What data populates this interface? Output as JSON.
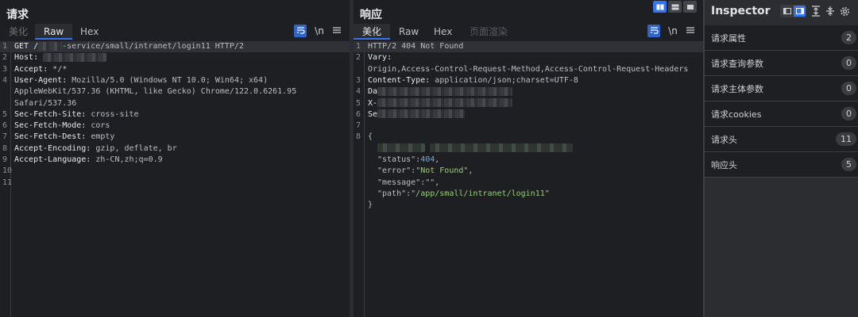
{
  "request": {
    "title": "请求",
    "tabs": [
      "美化",
      "Raw",
      "Hex"
    ],
    "active_tab": "Raw",
    "newline_label": "\\n",
    "menu_icon": "hamburger-icon",
    "lines": [
      {
        "n": "1",
        "k": "GET /",
        "v": "-service/small/intranet/login11 HTTP/2"
      },
      {
        "n": "2",
        "k": "Host: ",
        "v": ""
      },
      {
        "n": "3",
        "k": "Accept: ",
        "v": "*/*"
      },
      {
        "n": "4",
        "k": "User-Agent: ",
        "v": "Mozilla/5.0 (Windows NT 10.0; Win64; x64)"
      },
      {
        "n": "",
        "k": "",
        "v": "AppleWebKit/537.36 (KHTML, like Gecko) Chrome/122.0.6261.95"
      },
      {
        "n": "",
        "k": "",
        "v": "Safari/537.36"
      },
      {
        "n": "5",
        "k": "Sec-Fetch-Site: ",
        "v": "cross-site"
      },
      {
        "n": "6",
        "k": "Sec-Fetch-Mode: ",
        "v": "cors"
      },
      {
        "n": "7",
        "k": "Sec-Fetch-Dest: ",
        "v": "empty"
      },
      {
        "n": "8",
        "k": "Accept-Encoding: ",
        "v": "gzip, deflate, br"
      },
      {
        "n": "9",
        "k": "Accept-Language: ",
        "v": "zh-CN,zh;q=0.9"
      },
      {
        "n": "10",
        "k": "",
        "v": ""
      },
      {
        "n": "11",
        "k": "",
        "v": ""
      }
    ]
  },
  "response": {
    "title": "响应",
    "tabs": [
      "美化",
      "Raw",
      "Hex",
      "页面渲染"
    ],
    "active_tab": "美化",
    "newline_label": "\\n",
    "lines": [
      {
        "n": "1",
        "k": "",
        "v": "HTTP/2 404 Not Found"
      },
      {
        "n": "2",
        "k": "Vary: ",
        "v": ""
      },
      {
        "n": "",
        "k": "",
        "v": "Origin,Access-Control-Request-Method,Access-Control-Request-Headers"
      },
      {
        "n": "3",
        "k": "Content-Type: ",
        "v": "application/json;charset=UTF-8"
      },
      {
        "n": "4",
        "k": "Da",
        "v": ""
      },
      {
        "n": "5",
        "k": "X-",
        "v": ""
      },
      {
        "n": "6",
        "k": "Se",
        "v": ""
      },
      {
        "n": "7",
        "k": "",
        "v": ""
      },
      {
        "n": "8",
        "k": "",
        "v": "{"
      },
      {
        "n": "",
        "k": "",
        "v": ""
      }
    ],
    "json": [
      {
        "key": "\"status\"",
        "val": "404",
        "type": "num",
        "tail": ","
      },
      {
        "key": "\"error\"",
        "val": "\"Not Found\"",
        "type": "str",
        "tail": ","
      },
      {
        "key": "\"message\"",
        "val": "\"\"",
        "type": "str",
        "tail": ","
      },
      {
        "key": "\"path\"",
        "val": "\"/app/small/intranet/login11\"",
        "type": "str",
        "tail": ""
      }
    ],
    "closing_brace": "}"
  },
  "inspector": {
    "title": "Inspector",
    "rows": [
      {
        "label": "请求属性",
        "count": "2"
      },
      {
        "label": "请求查询参数",
        "count": "0"
      },
      {
        "label": "请求主体参数",
        "count": "0"
      },
      {
        "label": "请求cookies",
        "count": "0"
      },
      {
        "label": "请求头",
        "count": "11"
      },
      {
        "label": "响应头",
        "count": "5"
      }
    ]
  },
  "colors": {
    "accent": "#3574f0",
    "background": "#1e1f22",
    "panel": "#2b2d30"
  }
}
